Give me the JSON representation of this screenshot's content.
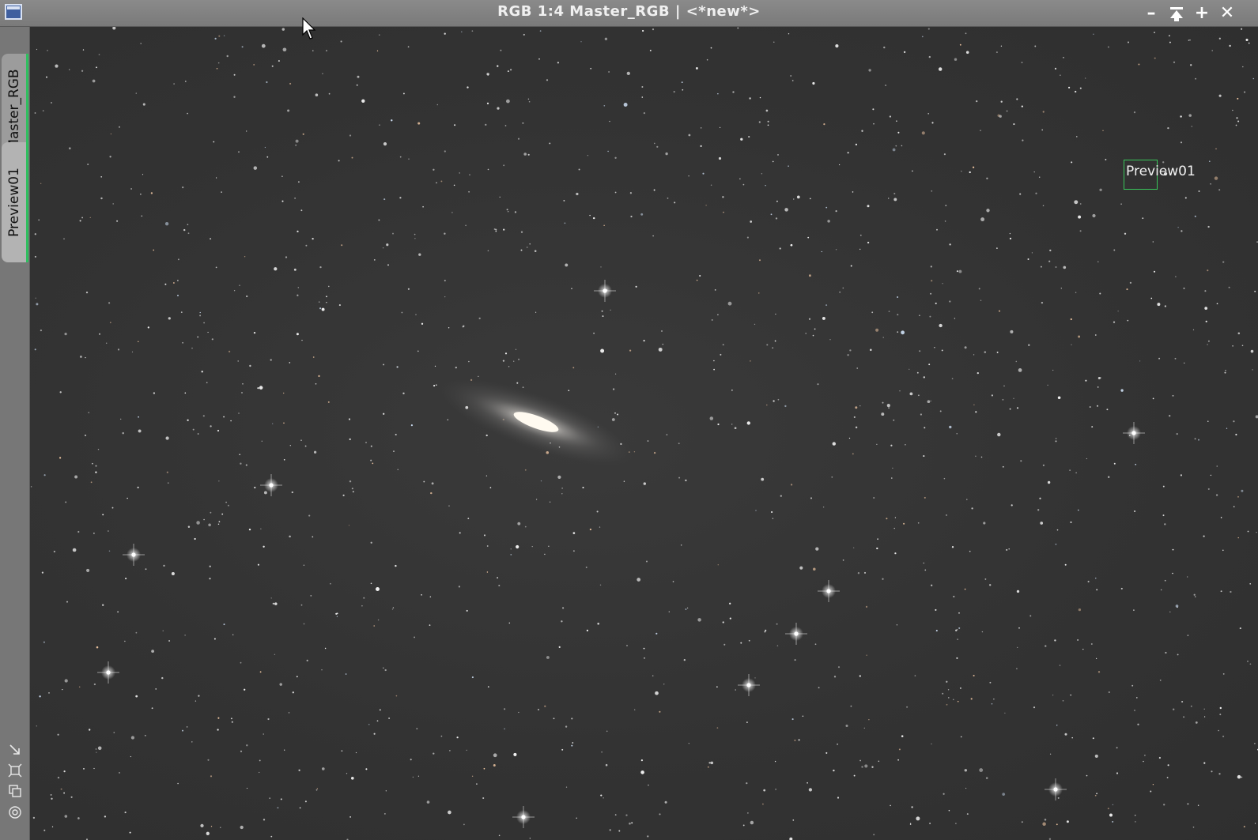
{
  "window": {
    "title": "RGB 1:4 Master_RGB | <*new*>",
    "buttons": {
      "minimize": "–",
      "shade": "⤒",
      "maximize": "+",
      "close": "✕"
    }
  },
  "side_tabs": [
    {
      "label": "Master_RGB",
      "active": false
    },
    {
      "label": "Preview01",
      "active": true
    }
  ],
  "side_tools": [
    "zoom-to-fit-icon",
    "fit-window-icon",
    "clone-window-icon",
    "target-icon"
  ],
  "preview": {
    "label": "Preview01",
    "border_color": "#39c65a"
  },
  "colors": {
    "tab_accent": "#2fbf5f",
    "titlebar": "#808080",
    "sky": "#333333"
  }
}
